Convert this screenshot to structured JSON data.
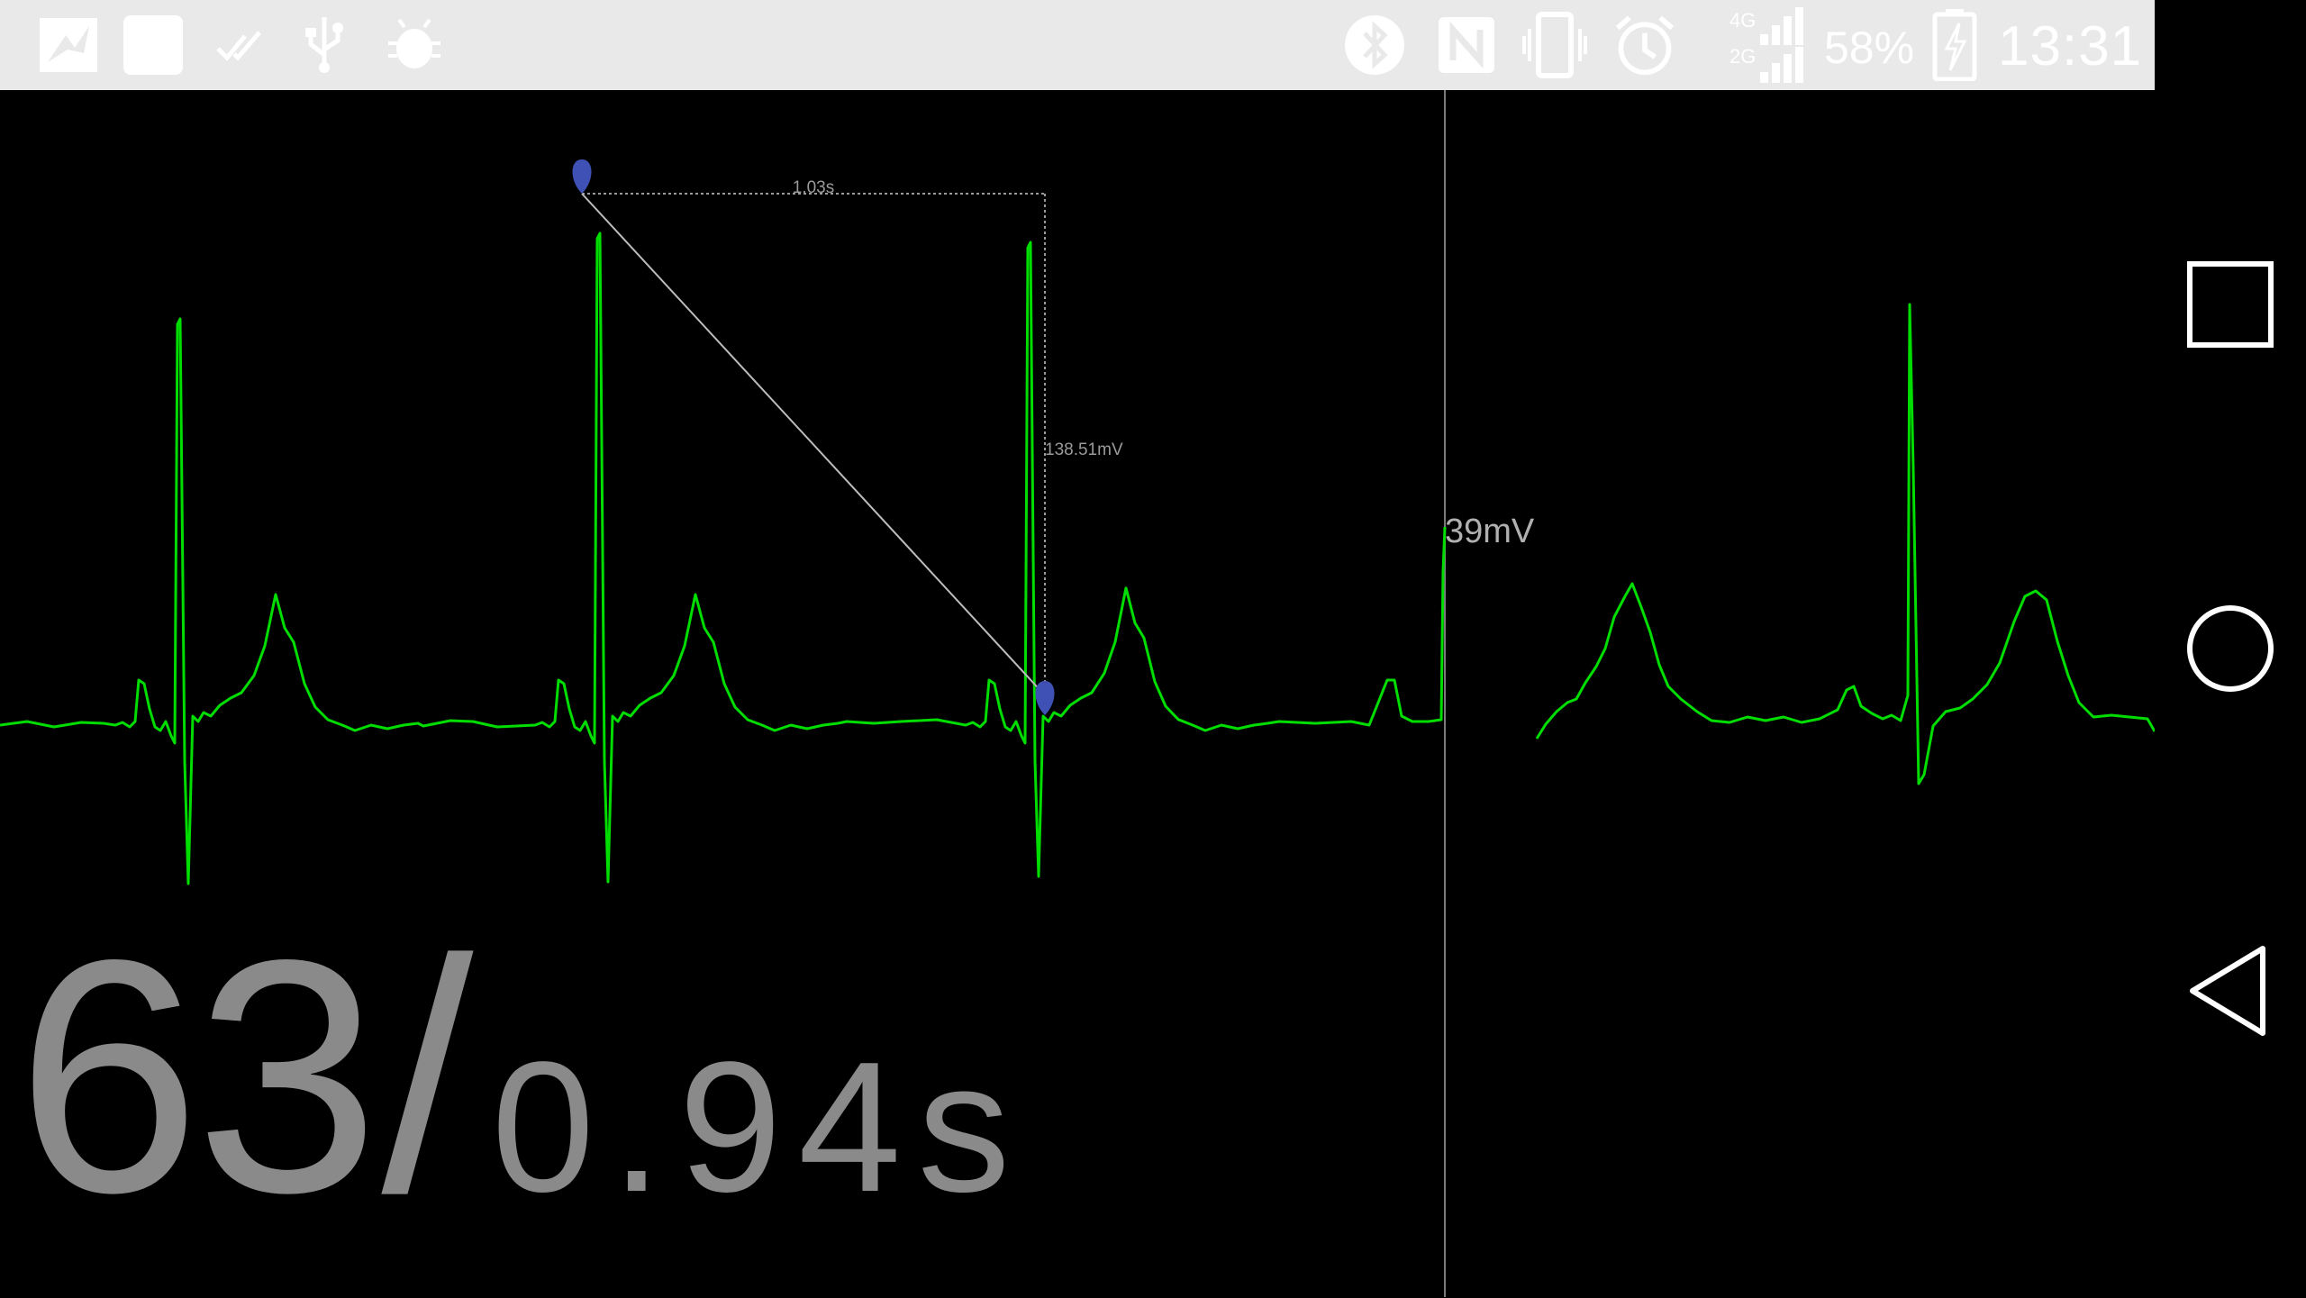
{
  "status_bar": {
    "battery_percent": "58%",
    "time": "13:31",
    "network_labels": [
      "4G",
      "2G"
    ],
    "icons": [
      "app-logo-icon",
      "app-square-icon",
      "done-all-icon",
      "usb-icon",
      "android-debug-icon",
      "bluetooth-icon",
      "nfc-icon",
      "vibrate-icon",
      "alarm-icon",
      "signal-icon",
      "battery-charging-icon"
    ]
  },
  "ecg": {
    "trace_color": "#00dd00",
    "marker_color": "#3f51b5",
    "measure_time_label": "1.03s",
    "measure_voltage_label": "138.51mV",
    "cursor_value_label": "39mV"
  },
  "readout": {
    "bpm": "63",
    "separator": "/",
    "interval": "0.94s"
  },
  "nav_bar": {
    "buttons": [
      "recent-apps-icon",
      "home-icon",
      "back-icon"
    ]
  }
}
